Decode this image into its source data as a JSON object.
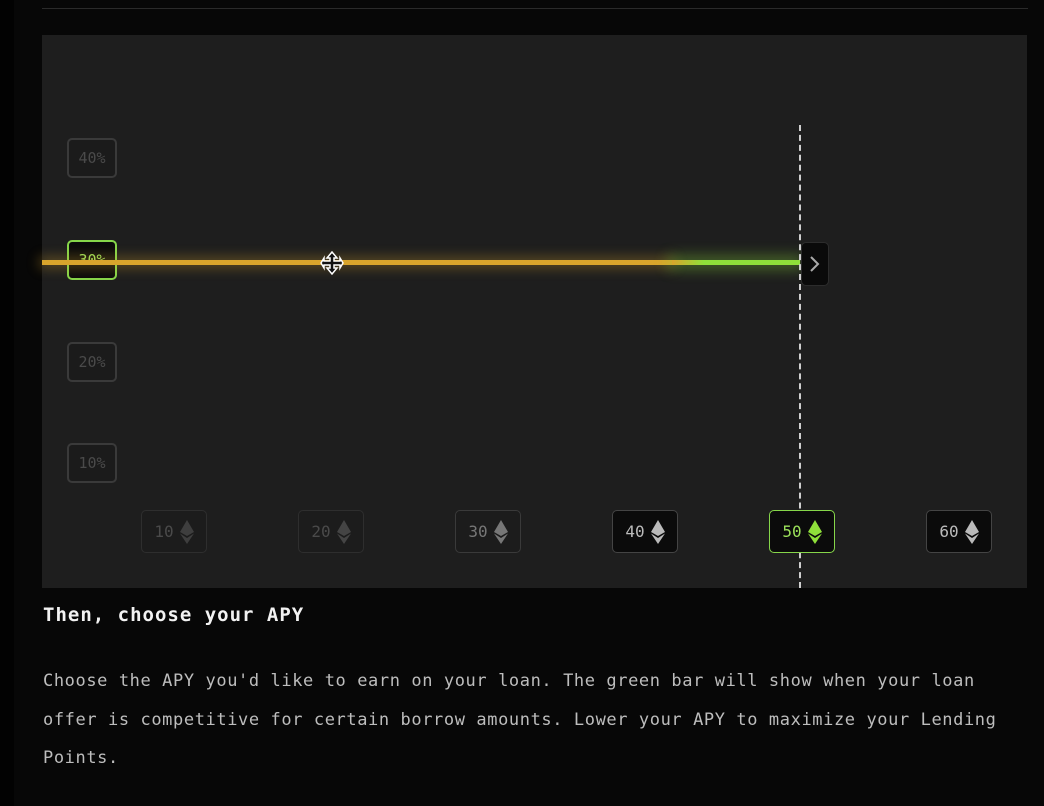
{
  "chart": {
    "y_labels": [
      "40%",
      "30%",
      "20%",
      "10%"
    ],
    "x_labels": [
      "10",
      "20",
      "30",
      "40",
      "50",
      "60"
    ],
    "x_unit_icon": "ethereum-icon",
    "selected_apy": "30%",
    "selected_amount": "50",
    "competitive_from_amount": 45,
    "colors": {
      "apy_line": "#d9a52c",
      "competitive": "#8fe03a"
    }
  },
  "section": {
    "title": "Then, choose your APY",
    "description": "Choose the APY you'd like to earn on your loan. The green bar will show when your loan offer is competitive for certain borrow amounts. Lower your APY to maximize your Lending Points."
  }
}
